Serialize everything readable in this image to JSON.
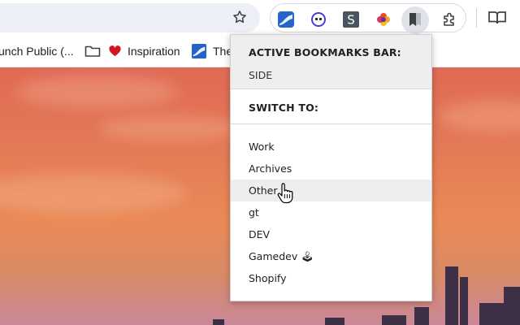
{
  "toolbar": {
    "star_icon": "star-icon",
    "extensions": [
      {
        "name": "ext-blue-wave-icon",
        "color": "#2563c8"
      },
      {
        "name": "ext-face-icon",
        "color": "#4a3fd1"
      },
      {
        "name": "ext-s-icon",
        "glyph": "S",
        "color": "#4a5560"
      },
      {
        "name": "ext-flower-icon",
        "color": "#e84a2a"
      },
      {
        "name": "ext-bookmark-switch-icon",
        "color": "#3c4043"
      },
      {
        "name": "puzzle-icon",
        "color": "#3c4043"
      }
    ],
    "reader_icon": "reading-list-icon"
  },
  "bookmarks": [
    {
      "label": "unch Public (..."
    },
    {
      "label": "",
      "icon": "folder-icon"
    },
    {
      "label": "Inspiration",
      "icon": "heart-icon"
    },
    {
      "label": "The",
      "icon": "blue-wave-icon"
    }
  ],
  "popup": {
    "active_heading": "ACTIVE BOOKMARKS BAR:",
    "active_value": "SIDE",
    "switch_heading": "SWITCH TO:",
    "items": [
      {
        "label": "Work"
      },
      {
        "label": "Archives"
      },
      {
        "label": "Other"
      },
      {
        "label": "gt"
      },
      {
        "label": "DEV"
      },
      {
        "label": "Gamedev 🕹"
      },
      {
        "label": "Shopify"
      }
    ],
    "hovered_index": 2
  },
  "colors": {
    "sky_top": "#e06a55",
    "sky_bottom": "#c9879a",
    "popup_bg": "#ffffff",
    "hover_bg": "#eeeeee"
  }
}
